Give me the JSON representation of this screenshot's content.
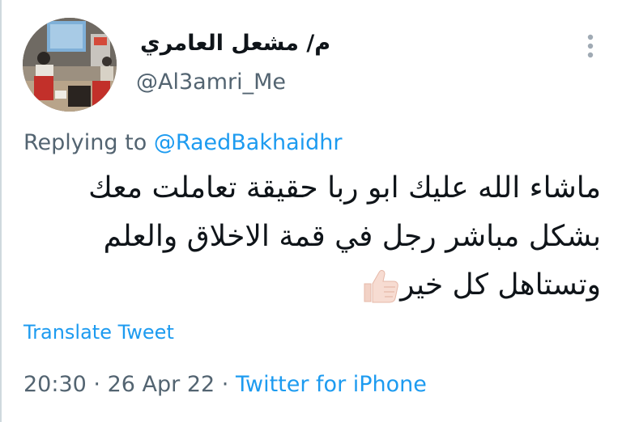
{
  "tweet": {
    "author": {
      "display_name": "م/ مشعل العامري",
      "handle": "@Al3amri_Me"
    },
    "replying_prefix": "Replying to",
    "replying_to": "@RaedBakhaidhr",
    "text_lines": [
      "ماشاء الله عليك ابو ربا حقيقة تعاملت معك",
      "بشكل مباشر رجل في قمة الاخلاق والعلم",
      "وتستاهل كل خير"
    ],
    "emoji": "thumbs-up-icon",
    "translate_label": "Translate Tweet",
    "time": "20:30",
    "separator": "·",
    "date": "26 Apr 22",
    "source": "Twitter for iPhone"
  },
  "colors": {
    "accent": "#1d9bf0",
    "secondary_text": "#536471",
    "primary_text": "#0f1419"
  }
}
